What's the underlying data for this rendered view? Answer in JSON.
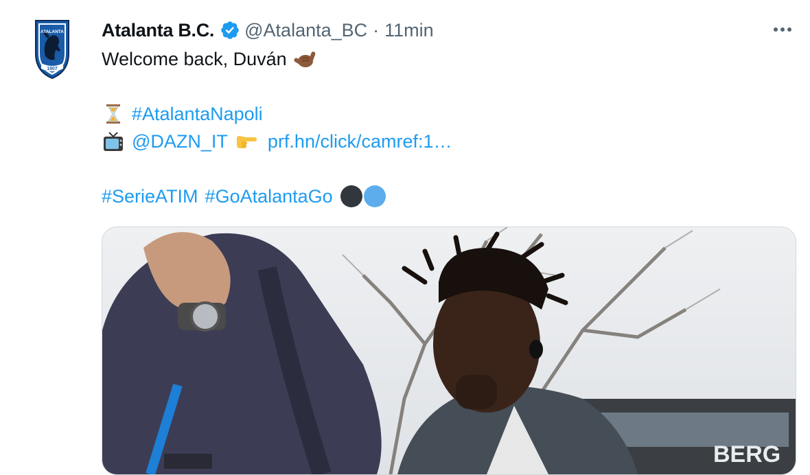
{
  "tweet": {
    "author": {
      "display_name": "Atalanta B.C.",
      "handle": "@Atalanta_BC",
      "verified": true,
      "avatar_icon": "atalanta-crest-icon",
      "avatar_text": "ATALANTA",
      "avatar_year": "1907"
    },
    "separator": "·",
    "timestamp": "11min",
    "more_icon": "more-horizontal-icon",
    "lines": {
      "line1_text": "Welcome back, Duván",
      "line1_emoji": "call-me-hand-emoji",
      "line2_emoji": "hourglass-emoji",
      "line2_hashtag": "#AtalantaNapoli",
      "line3_emoji": "television-emoji",
      "line3_mention": "@DAZN_IT",
      "line3_pointer_emoji": "pointing-right-emoji",
      "line3_link": "prf.hn/click/camref:1…",
      "line4_hashtag1": "#SerieATIM",
      "line4_hashtag2": "#GoAtalantaGo",
      "line4_emojis": [
        "black-circle-emoji",
        "blue-circle-emoji"
      ]
    },
    "media": {
      "type": "photo",
      "visible_sign_text": "BERG"
    }
  },
  "colors": {
    "link": "#1d9bf0",
    "secondary_text": "#536471",
    "primary_text": "#0f1419",
    "verified_badge": "#1d9bf0",
    "border": "#cfd9de"
  }
}
